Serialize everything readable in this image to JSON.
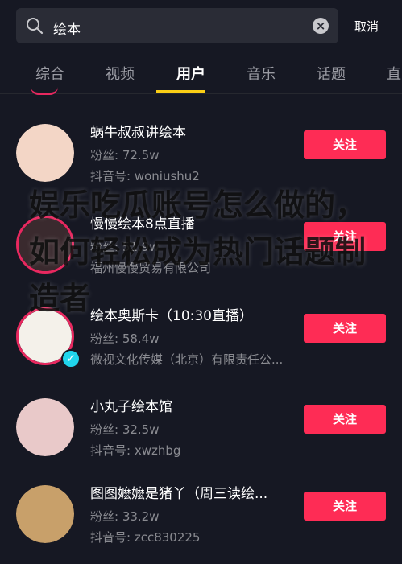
{
  "search": {
    "query": "绘本",
    "action_label": "取消"
  },
  "tabs": [
    {
      "label": "综合"
    },
    {
      "label": "视频"
    },
    {
      "label": "用户"
    },
    {
      "label": "音乐"
    },
    {
      "label": "话题"
    },
    {
      "label": "直"
    }
  ],
  "active_tab": "用户",
  "users": [
    {
      "name": "蜗牛叔叔讲绘本",
      "fans": "粉丝: 72.5w",
      "subline": "抖音号: woniushu2",
      "follow_label": "关注",
      "avatar_color": "#f3d6c6"
    },
    {
      "name": "慢慢绘本8点直播",
      "fans": "粉丝: 51.9w",
      "subline": "福州慢慢贸易有限公司",
      "follow_label": "关注",
      "avatar_color": "#3a2a2e"
    },
    {
      "name": "绘本奥斯卡（10:30直播）",
      "fans": "粉丝: 58.4w",
      "subline": "微视文化传媒（北京）有限责任公...",
      "follow_label": "关注",
      "avatar_color": "#f4f1ea"
    },
    {
      "name": "小丸子绘本馆",
      "fans": "粉丝: 32.5w",
      "subline": "抖音号: xwzhbg",
      "follow_label": "关注",
      "avatar_color": "#e9c9c9"
    },
    {
      "name": "图图嬷嬷是猪丫（周三读绘...",
      "fans": "粉丝: 33.2w",
      "subline": "抖音号: zcc830225",
      "follow_label": "关注",
      "avatar_color": "#c8a06a"
    }
  ],
  "watermark": "娱乐吃瓜账号怎么做的，如何轻松成为热门话题制造者",
  "colors": {
    "background": "#161823",
    "follow_button": "#fe2c55",
    "tab_indicator": "#face15",
    "live_ring": "#e8285f",
    "verified_badge": "#20d5ec"
  }
}
